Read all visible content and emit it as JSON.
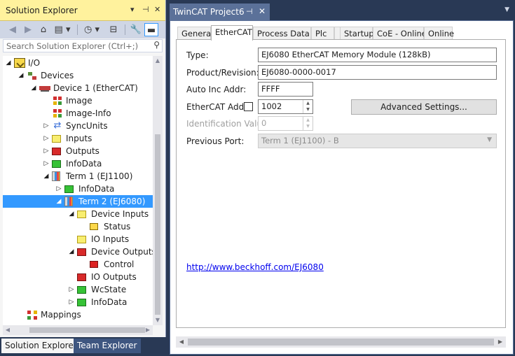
{
  "solution_explorer": {
    "title": "Solution Explorer",
    "title_buttons": {
      "dropdown": "▾",
      "pin": "⊣",
      "close": "✕"
    },
    "toolbar": [
      {
        "name": "back-icon",
        "glyph": "◀"
      },
      {
        "name": "forward-icon",
        "glyph": "▶"
      },
      {
        "name": "home-icon",
        "glyph": "⌂"
      },
      {
        "name": "switch-views-icon",
        "glyph": "▤"
      },
      {
        "name": "history-icon",
        "glyph": "◷"
      },
      {
        "name": "collapse-all-icon",
        "glyph": "⊟"
      },
      {
        "name": "properties-icon",
        "glyph": "🔧"
      },
      {
        "name": "preview-icon",
        "glyph": "▬"
      }
    ],
    "search_placeholder": "Search Solution Explorer (Ctrl+;)",
    "search_icon": "⚲",
    "tree": [
      {
        "label": "I/O",
        "icon": "io",
        "twisty": "◢",
        "level": 0
      },
      {
        "label": "Devices",
        "icon": "devices",
        "twisty": "◢",
        "level": 1
      },
      {
        "label": "Device 1 (EtherCAT)",
        "icon": "device",
        "twisty": "◢",
        "level": 2
      },
      {
        "label": "Image",
        "icon": "image",
        "twisty": "",
        "level": 3
      },
      {
        "label": "Image-Info",
        "icon": "image",
        "twisty": "",
        "level": 3
      },
      {
        "label": "SyncUnits",
        "icon": "sync",
        "twisty": "▷",
        "level": 3
      },
      {
        "label": "Inputs",
        "icon": "yellow",
        "twisty": "▷",
        "level": 3
      },
      {
        "label": "Outputs",
        "icon": "red",
        "twisty": "▷",
        "level": 3
      },
      {
        "label": "InfoData",
        "icon": "green",
        "twisty": "▷",
        "level": 3
      },
      {
        "label": "Term 1 (EJ1100)",
        "icon": "term",
        "twisty": "◢",
        "level": 3
      },
      {
        "label": "InfoData",
        "icon": "green",
        "twisty": "▷",
        "level": 4
      },
      {
        "label": "Term 2 (EJ6080)",
        "icon": "term",
        "twisty": "◢",
        "level": 4,
        "selected": true
      },
      {
        "label": "Device Inputs",
        "icon": "yellow",
        "twisty": "◢",
        "level": 5
      },
      {
        "label": "Status",
        "icon": "var",
        "twisty": "",
        "level": 6
      },
      {
        "label": "IO Inputs",
        "icon": "yellow",
        "twisty": "",
        "level": 5
      },
      {
        "label": "Device Outputs",
        "icon": "red",
        "twisty": "◢",
        "level": 5
      },
      {
        "label": "Control",
        "icon": "var-red",
        "twisty": "",
        "level": 6
      },
      {
        "label": "IO Outputs",
        "icon": "red",
        "twisty": "",
        "level": 5
      },
      {
        "label": "WcState",
        "icon": "green",
        "twisty": "▷",
        "level": 5
      },
      {
        "label": "InfoData",
        "icon": "green",
        "twisty": "▷",
        "level": 5
      },
      {
        "label": "Mappings",
        "icon": "map",
        "twisty": "",
        "level": 1
      }
    ],
    "bottom_tabs": [
      "Solution Explorer",
      "Team Explorer"
    ]
  },
  "document": {
    "tab_title": "TwinCAT Project6",
    "pin_glyph": "⊣",
    "close_glyph": "✕",
    "dropdown_glyph": "▼",
    "property_tabs": [
      "General",
      "EtherCAT",
      "Process Data",
      "Plc",
      "Startup",
      "CoE - Online",
      "Online"
    ],
    "active_tab": "EtherCAT",
    "fields": {
      "type_label": "Type:",
      "type_value": "EJ6080 EtherCAT Memory Module (128kB)",
      "product_label": "Product/Revision:",
      "product_value": "EJ6080-0000-0017",
      "autoinc_label": "Auto Inc Addr:",
      "autoinc_value": "FFFF",
      "ecat_label": "EtherCAT Addr:",
      "ecat_value": "1002",
      "advanced_button": "Advanced Settings...",
      "ident_label": "Identification Value:",
      "ident_value": "0",
      "prevport_label": "Previous Port:",
      "prevport_value": "Term 1 (EJ1100) - B"
    },
    "link": "http://www.beckhoff.com/EJ6080"
  }
}
